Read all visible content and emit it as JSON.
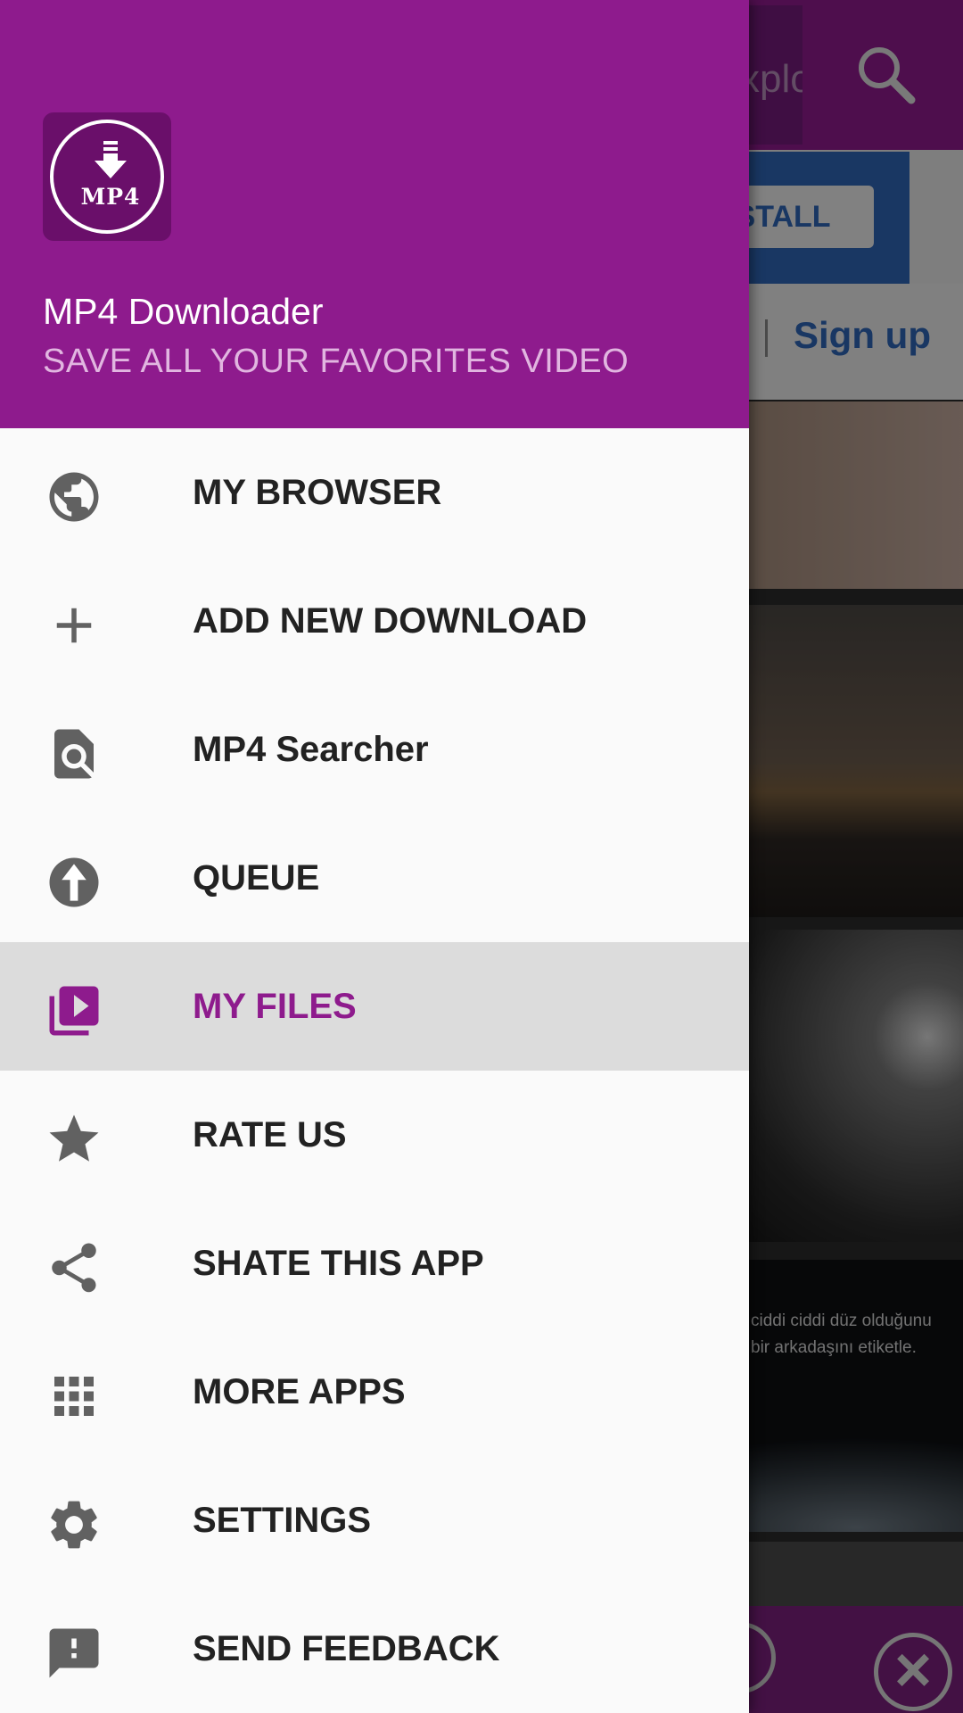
{
  "app": {
    "name": "MP4 Downloader",
    "tagline": "SAVE ALL YOUR FAVORITES VIDEO",
    "logo_text": "MP4"
  },
  "drawer": {
    "items": [
      {
        "label": "MY BROWSER",
        "icon": "globe-icon",
        "active": false
      },
      {
        "label": "ADD NEW DOWNLOAD",
        "icon": "plus-icon",
        "active": false
      },
      {
        "label": "MP4 Searcher",
        "icon": "file-search-icon",
        "active": false
      },
      {
        "label": "QUEUE",
        "icon": "upload-arrow-icon",
        "active": false
      },
      {
        "label": "MY FILES",
        "icon": "video-library-icon",
        "active": true
      },
      {
        "label": "RATE US",
        "icon": "star-icon",
        "active": false
      },
      {
        "label": "SHATE THIS APP",
        "icon": "share-icon",
        "active": false
      },
      {
        "label": "MORE APPS",
        "icon": "apps-grid-icon",
        "active": false
      },
      {
        "label": "SETTINGS",
        "icon": "gear-icon",
        "active": false
      },
      {
        "label": "SEND FEEDBACK",
        "icon": "feedback-icon",
        "active": false
      }
    ]
  },
  "background": {
    "search_text": "xplo",
    "install_label": "NSTALL",
    "signup_label": "Sign up",
    "caption_lines": [
      "ciddi ciddi düz olduğunu",
      "bir arkadaşını etiketle."
    ]
  },
  "colors": {
    "primary": "#8e1b8d",
    "tagline": "#e1b6e0",
    "active_row": "#dcdcdc",
    "icon_gray": "#616161",
    "link_blue": "#2f64b5"
  }
}
